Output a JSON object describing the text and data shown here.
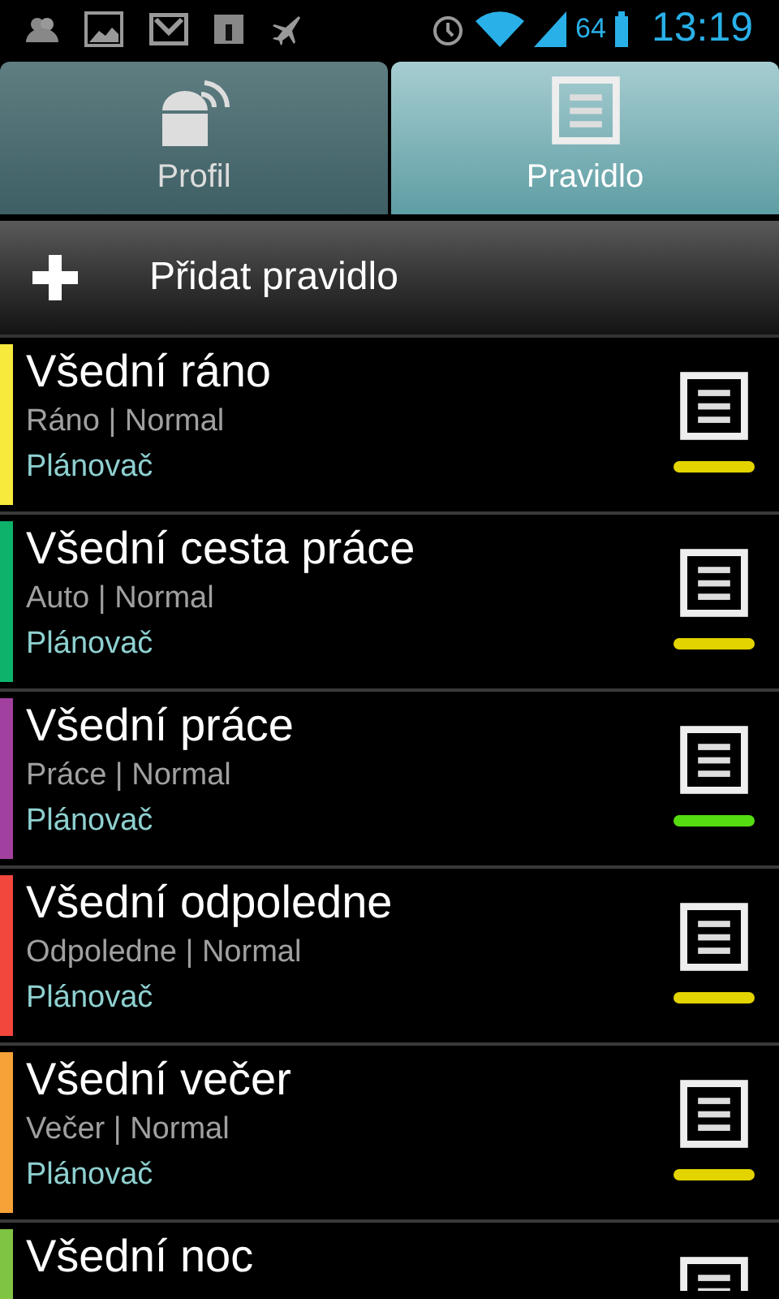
{
  "status_bar": {
    "battery": "64",
    "time": "13:19"
  },
  "tabs": [
    {
      "label": "Profil",
      "selected": false,
      "kind": "robot"
    },
    {
      "label": "Pravidlo",
      "selected": true,
      "kind": "list"
    }
  ],
  "add_button": {
    "label": "Přidat pravidlo"
  },
  "rules": [
    {
      "title": "Všední ráno",
      "subtitle": "Ráno | Normal",
      "trigger": "Plánovač",
      "color": "#f7ea3c",
      "indicator": {
        "color": "#e3d400"
      }
    },
    {
      "title": "Všední cesta práce",
      "subtitle": "Auto | Normal",
      "trigger": "Plánovač",
      "color": "#0db36b",
      "indicator": {
        "color": "#e3d400"
      }
    },
    {
      "title": "Všední práce",
      "subtitle": "Práce | Normal",
      "trigger": "Plánovač",
      "color": "#a2409f",
      "indicator": {
        "color": "#55dd11"
      }
    },
    {
      "title": "Všední odpoledne",
      "subtitle": "Odpoledne | Normal",
      "trigger": "Plánovač",
      "color": "#f2473d",
      "indicator": {
        "color": "#e3d400"
      }
    },
    {
      "title": "Všední večer",
      "subtitle": "Večer | Normal",
      "trigger": "Plánovač",
      "color": "#f7a236",
      "indicator": {
        "color": "#e3d400"
      }
    },
    {
      "title": "Všední noc",
      "color": "#80c443"
    }
  ]
}
